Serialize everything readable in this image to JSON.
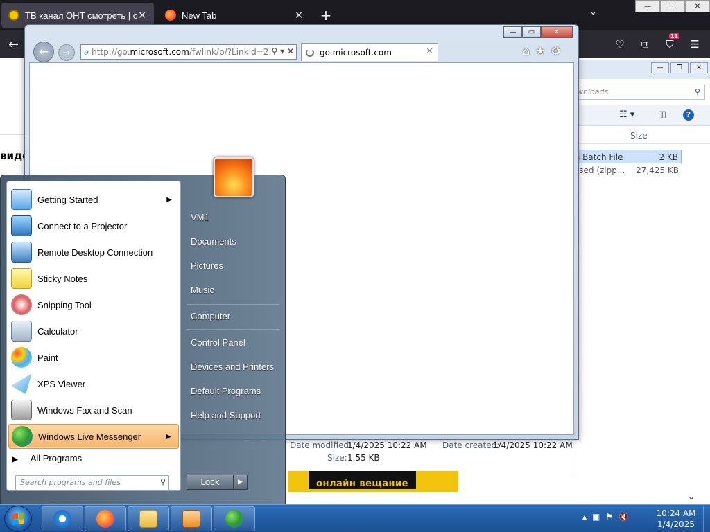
{
  "firefox": {
    "tabs": [
      {
        "label": "ТВ канал ОНТ смотреть | онла",
        "close": "✕"
      },
      {
        "label": "New Tab",
        "close": "✕"
      }
    ],
    "new_tab": "+",
    "list_all": "⌄",
    "back": "←",
    "badge": "11",
    "menu": "☰",
    "page_fragment": "видеі",
    "banner_text": "онлайн вещание"
  },
  "explorer": {
    "search_placeholder": "wnloads",
    "column_size": "Size",
    "rows": [
      {
        "type": "s Batch File",
        "size": "2 KB"
      },
      {
        "type": "ssed (zipp...",
        "size": "27,425 KB"
      }
    ]
  },
  "details": {
    "modified_label": "Date modified:",
    "modified_value": "1/4/2025 10:22 AM",
    "created_label": "Date created:",
    "created_value": "1/4/2025 10:22 AM",
    "size_label": "Size:",
    "size_value": "1.55 KB"
  },
  "ie": {
    "address_prefix": "http://go.",
    "address_host": "microsoft.com",
    "address_rest": "/fwlink/p/?LinkId=2",
    "tab_title": "go.microsoft.com",
    "tab_close": "✕"
  },
  "start_menu": {
    "programs": [
      {
        "label": "Getting Started",
        "arrow": "▶"
      },
      {
        "label": "Connect to a Projector",
        "arrow": ""
      },
      {
        "label": "Remote Desktop Connection",
        "arrow": ""
      },
      {
        "label": "Sticky Notes",
        "arrow": ""
      },
      {
        "label": "Snipping Tool",
        "arrow": ""
      },
      {
        "label": "Calculator",
        "arrow": ""
      },
      {
        "label": "Paint",
        "arrow": ""
      },
      {
        "label": "XPS Viewer",
        "arrow": ""
      },
      {
        "label": "Windows Fax and Scan",
        "arrow": ""
      },
      {
        "label": "Windows Live Messenger",
        "arrow": "▶"
      }
    ],
    "all_programs": "All Programs",
    "search_placeholder": "Search programs and files",
    "right_items": [
      "VM1",
      "Documents",
      "Pictures",
      "Music",
      "Computer",
      "Control Panel",
      "Devices and Printers",
      "Default Programs",
      "Help and Support"
    ],
    "lock_label": "Lock",
    "lock_arrow": "▶"
  },
  "taskbar": {
    "time": "10:24 AM",
    "date": "1/4/2025"
  },
  "colors": {
    "highlight": "#f6b46a",
    "taskbar": "#1a4f94",
    "firefox_dark": "#1c1b22"
  }
}
